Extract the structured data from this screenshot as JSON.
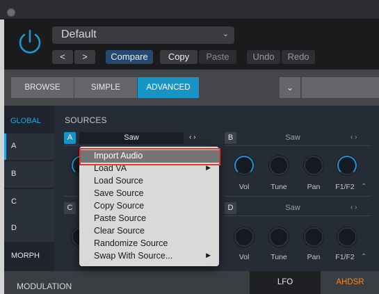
{
  "header": {
    "preset_name": "Default",
    "prev_label": "<",
    "next_label": ">",
    "compare_label": "Compare",
    "copy_label": "Copy",
    "paste_label": "Paste",
    "undo_label": "Undo",
    "redo_label": "Redo"
  },
  "modes": {
    "browse": "BROWSE",
    "simple": "SIMPLE",
    "advanced": "ADVANCED",
    "active": "ADVANCED"
  },
  "sidebar": {
    "global": "GLOBAL",
    "items": [
      "A",
      "B",
      "C",
      "D"
    ],
    "morph": "MORPH"
  },
  "sources": {
    "title": "SOURCES",
    "a": {
      "badge": "A",
      "name": "Saw"
    },
    "b": {
      "badge": "B",
      "name": "Saw"
    },
    "c": {
      "badge": "C"
    },
    "d": {
      "badge": "D",
      "name": "Saw"
    },
    "knob_labels": [
      "Vol",
      "Tune",
      "Pan",
      "F1/F2"
    ]
  },
  "context_menu": {
    "items": [
      "Import Audio",
      "Load VA",
      "Load Source",
      "Save Source",
      "Copy Source",
      "Paste Source",
      "Clear Source",
      "Randomize Source",
      "Swap With Source..."
    ],
    "highlighted": "Import Audio"
  },
  "bottom": {
    "modulation_label": "MODULATION",
    "lfo_label": "LFO",
    "ahdsr_label": "AHDSR"
  },
  "colors": {
    "accent_blue": "#1694c6",
    "compare_blue": "#27496e",
    "ahdsr_orange": "#f08a24",
    "highlight_red": "#e23a2a"
  },
  "icons": {
    "power": "power-icon",
    "preset_dropdown": "chevron-down-icon",
    "submenu": "triangle-right-icon"
  }
}
